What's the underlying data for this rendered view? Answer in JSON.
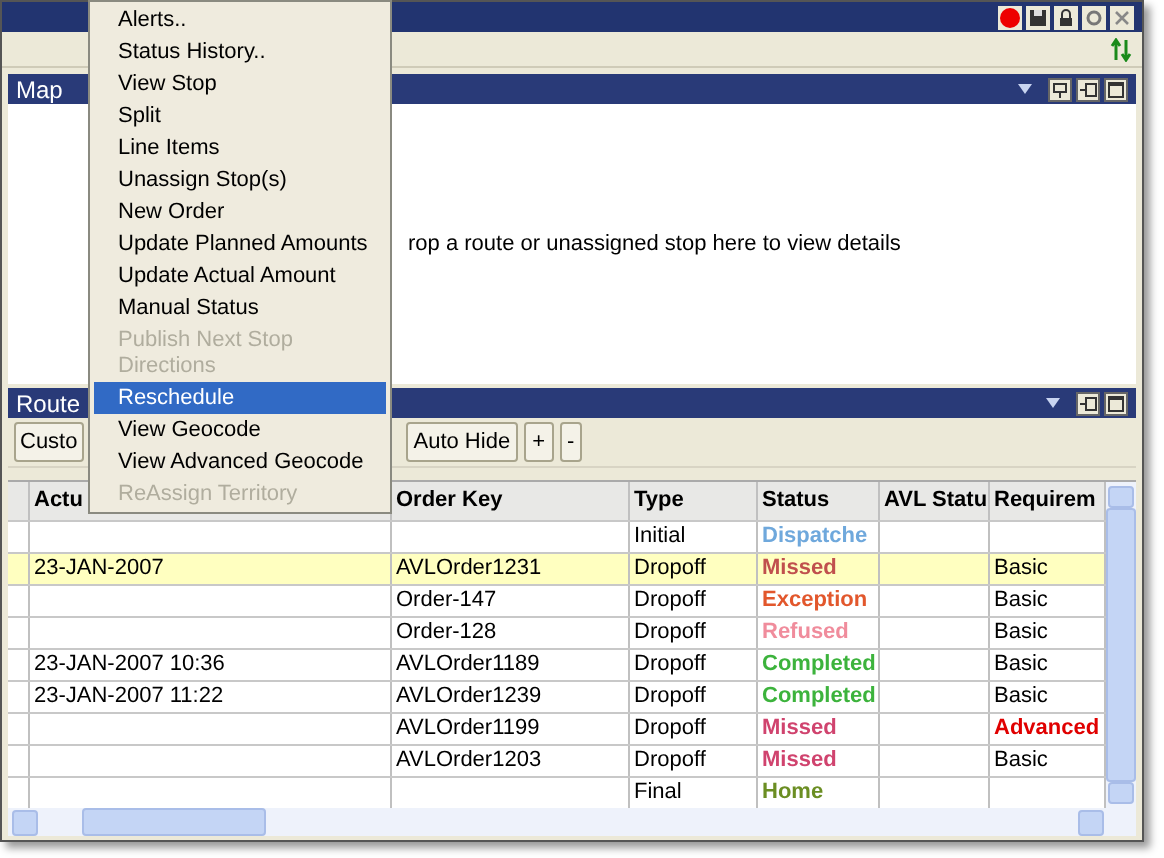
{
  "map_panel": {
    "title": "Map",
    "hint": "rop a route or unassigned stop here to view details"
  },
  "route_panel": {
    "title": "Route",
    "buttons": [
      "Custo",
      "Auto Hide",
      "+",
      "-"
    ]
  },
  "table": {
    "columns": [
      "Actu",
      "Order Key",
      "Type",
      "Status",
      "AVL Statu",
      "Requirem"
    ],
    "rows": [
      {
        "selected": false,
        "order_key": "",
        "type": "Initial",
        "status": {
          "text": "Dispatche",
          "color": "#6fa8dc"
        }
      },
      {
        "selected": true,
        "actual": "23-JAN-2007",
        "order_key": "AVLOrder1231",
        "type": "Dropoff",
        "status": {
          "text": "Missed",
          "color": "#c0504d"
        },
        "requirement": {
          "text": "Basic",
          "alert": false
        }
      },
      {
        "selected": false,
        "order_key": "Order-147",
        "type": "Dropoff",
        "status": {
          "text": "Exception",
          "color": "#e2572c"
        },
        "requirement": {
          "text": "Basic",
          "alert": false
        }
      },
      {
        "selected": false,
        "order_key": "Order-128",
        "type": "Dropoff",
        "status": {
          "text": "Refused",
          "color": "#f08c9c"
        },
        "requirement": {
          "text": "Basic",
          "alert": false
        }
      },
      {
        "selected": false,
        "actual": "23-JAN-2007 10:36",
        "order_key": "AVLOrder1189",
        "type": "Dropoff",
        "status": {
          "text": "Completed",
          "color": "#3cb33c"
        },
        "requirement": {
          "text": "Basic",
          "alert": false
        }
      },
      {
        "selected": false,
        "actual": "23-JAN-2007 11:22",
        "order_key": "AVLOrder1239",
        "type": "Dropoff",
        "status": {
          "text": "Completed",
          "color": "#3cb33c"
        },
        "requirement": {
          "text": "Basic",
          "alert": false
        }
      },
      {
        "selected": false,
        "order_key": "AVLOrder1199",
        "type": "Dropoff",
        "status": {
          "text": "Missed",
          "color": "#d0436e"
        },
        "requirement": {
          "text": "Advanced",
          "alert": true
        }
      },
      {
        "selected": false,
        "order_key": "AVLOrder1203",
        "type": "Dropoff",
        "status": {
          "text": "Missed",
          "color": "#d0436e"
        },
        "requirement": {
          "text": "Basic",
          "alert": false
        }
      },
      {
        "selected": false,
        "type": "Final",
        "status": {
          "text": "Home",
          "color": "#6b8e23"
        }
      }
    ]
  },
  "context_menu": {
    "items": [
      {
        "label": "Alerts..",
        "selected": false,
        "disabled": false
      },
      {
        "label": "Status History..",
        "selected": false,
        "disabled": false
      },
      {
        "label": "View Stop",
        "selected": false,
        "disabled": false
      },
      {
        "label": "Split",
        "selected": false,
        "disabled": false
      },
      {
        "label": "Line Items",
        "selected": false,
        "disabled": false
      },
      {
        "label": "Unassign Stop(s)",
        "selected": false,
        "disabled": false
      },
      {
        "label": "New Order",
        "selected": false,
        "disabled": false
      },
      {
        "label": "Update Planned Amounts",
        "selected": false,
        "disabled": false
      },
      {
        "label": "Update Actual Amount",
        "selected": false,
        "disabled": false
      },
      {
        "label": "Manual Status",
        "selected": false,
        "disabled": false
      },
      {
        "label": "Publish Next Stop Directions",
        "selected": false,
        "disabled": true
      },
      {
        "label": "Reschedule",
        "selected": true,
        "disabled": false
      },
      {
        "label": "View Geocode",
        "selected": false,
        "disabled": false
      },
      {
        "label": "View Advanced Geocode",
        "selected": false,
        "disabled": false
      },
      {
        "label": "ReAssign Territory",
        "selected": false,
        "disabled": true
      }
    ]
  }
}
